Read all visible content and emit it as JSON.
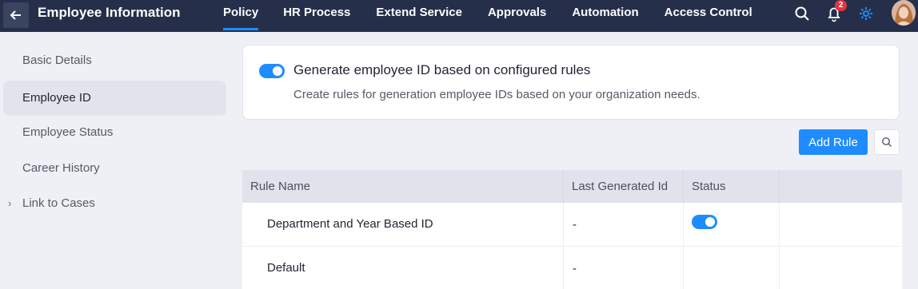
{
  "header": {
    "title": "Employee Information",
    "nav": [
      {
        "label": "Policy",
        "active": true
      },
      {
        "label": "HR Process",
        "active": false
      },
      {
        "label": "Extend Service",
        "active": false
      },
      {
        "label": "Approvals",
        "active": false
      },
      {
        "label": "Automation",
        "active": false
      },
      {
        "label": "Access Control",
        "active": false
      }
    ],
    "notification_count": "2"
  },
  "sidebar": {
    "items": [
      {
        "label": "Basic Details"
      },
      {
        "label": "Employee ID"
      },
      {
        "label": "Employee Status"
      },
      {
        "label": "Career History"
      },
      {
        "label": "Link to Cases"
      }
    ]
  },
  "settings_card": {
    "title": "Generate employee ID based on configured rules",
    "description": "Create rules for generation employee IDs based on your organization needs.",
    "enabled": true
  },
  "toolbar": {
    "add_rule_label": "Add Rule"
  },
  "table": {
    "headers": [
      "Rule Name",
      "Last Generated Id",
      "Status",
      ""
    ],
    "rows": [
      {
        "name": "Department and Year Based ID",
        "last_id": "-",
        "status_enabled": true
      },
      {
        "name": "Default",
        "last_id": "-",
        "status_enabled": null
      }
    ]
  },
  "colors": {
    "accent": "#1e8cff",
    "topbar": "#262f4a",
    "badge": "#e8333f"
  }
}
